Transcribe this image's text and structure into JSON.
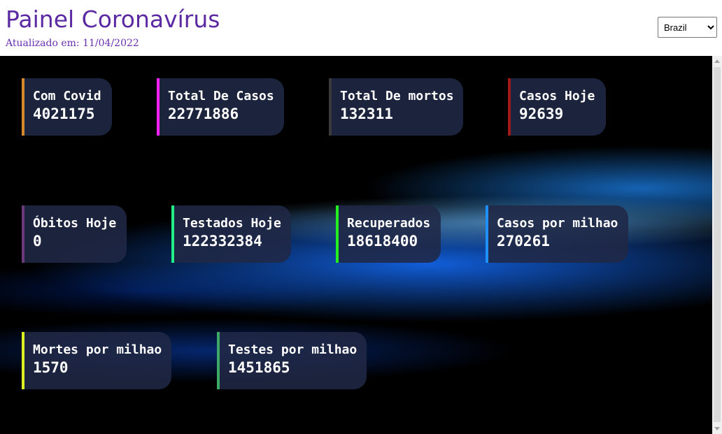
{
  "header": {
    "title": "Painel Coronavírus",
    "updated": "Atualizado em: 11/04/2022"
  },
  "country_select": {
    "selected": "Brazil"
  },
  "cards": [
    {
      "label": "Com Covid",
      "value": "4021175",
      "color": "#d4892a"
    },
    {
      "label": "Total De Casos",
      "value": "22771886",
      "color": "#ff22ff"
    },
    {
      "label": "Total De mortos",
      "value": "132311",
      "color": "#3a3a3a"
    },
    {
      "label": "Casos Hoje",
      "value": "92639",
      "color": "#a01818"
    },
    {
      "label": "Óbitos Hoje",
      "value": "0",
      "color": "#6a3a7a"
    },
    {
      "label": "Testados Hoje",
      "value": "122332384",
      "color": "#22ee88"
    },
    {
      "label": "Recuperados",
      "value": "18618400",
      "color": "#22ee22"
    },
    {
      "label": "Casos por milhao",
      "value": "270261",
      "color": "#1e90ff"
    },
    {
      "label": "Mortes por milhao",
      "value": "1570",
      "color": "#ddee22"
    },
    {
      "label": "Testes por milhao",
      "value": "1451865",
      "color": "#3caa66"
    }
  ]
}
